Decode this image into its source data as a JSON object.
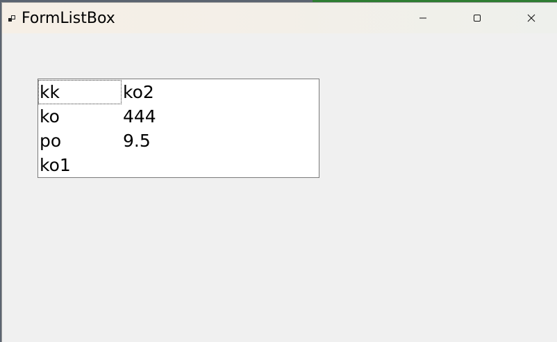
{
  "window": {
    "title": "FormListBox"
  },
  "caption_buttons": {
    "minimize_icon": "minimize-icon",
    "maximize_icon": "maximize-icon",
    "close_icon": "close-icon"
  },
  "listbox": {
    "columns": [
      [
        "kk",
        "ko",
        "po",
        "ko1"
      ],
      [
        "ko2",
        "444",
        "9.5"
      ]
    ],
    "focused_item": "kk"
  }
}
